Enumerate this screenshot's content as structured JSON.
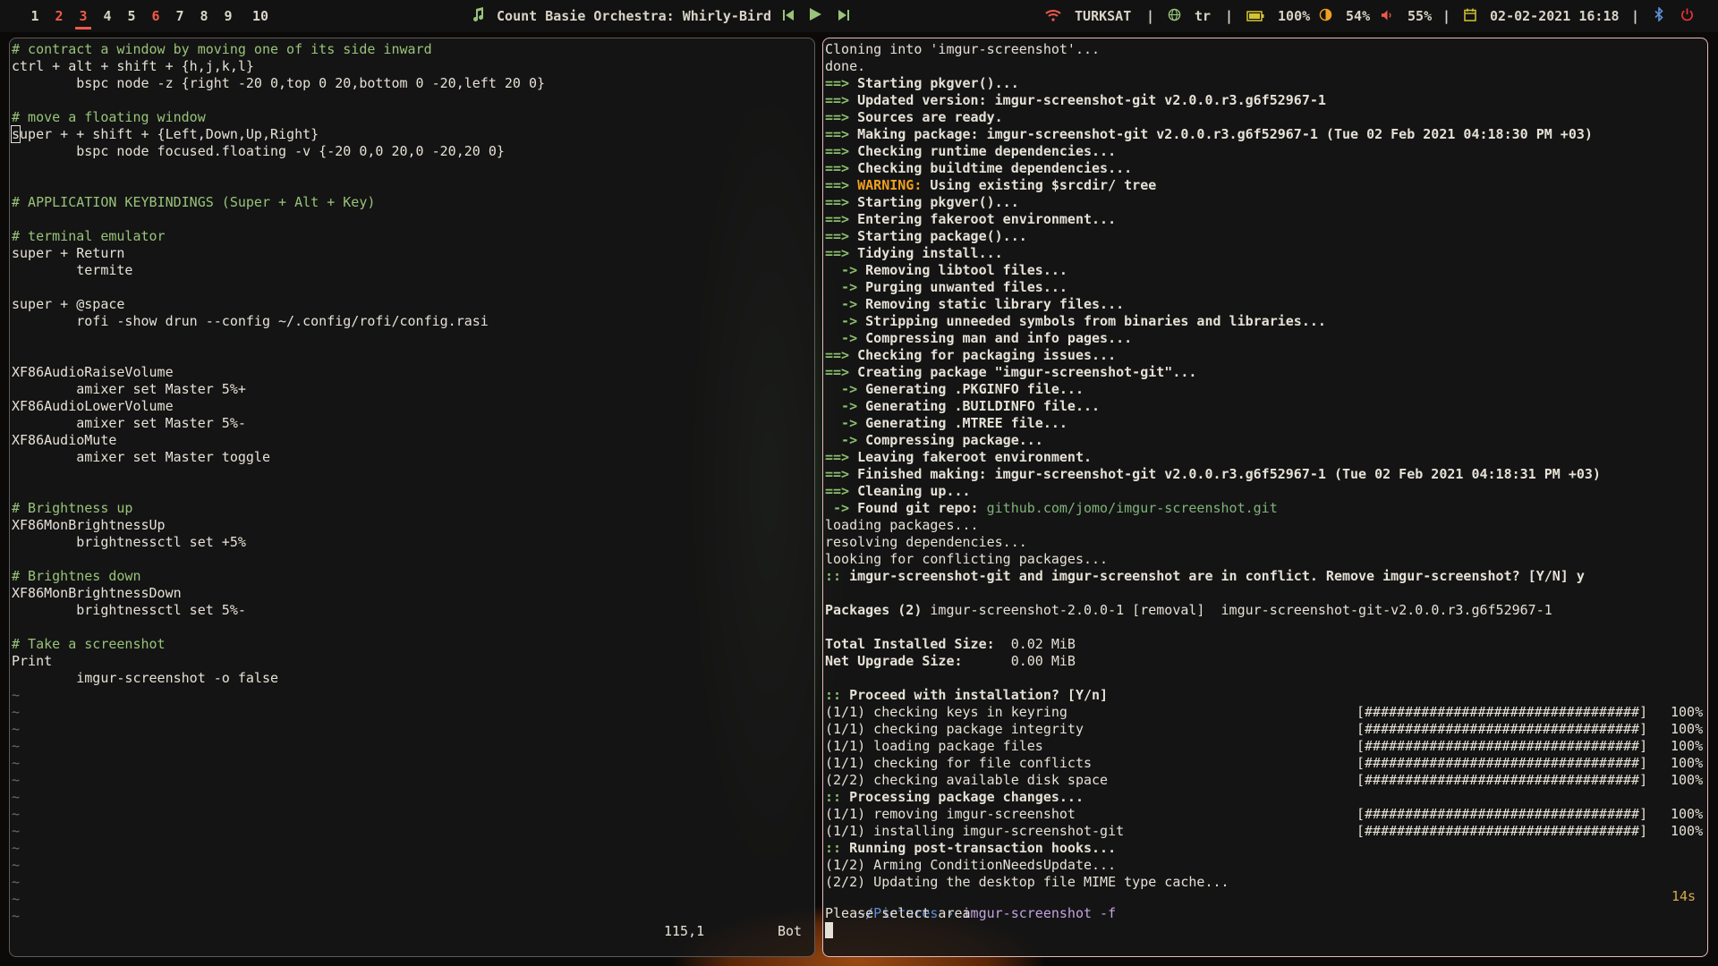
{
  "topbar": {
    "workspaces": [
      "1",
      "2",
      "3",
      "4",
      "5",
      "6",
      "7",
      "8",
      "9",
      "10"
    ],
    "active_workspace": "3",
    "now_playing": "Count Basie Orchestra: Whirly-Bird",
    "wifi": "TURKSAT",
    "layout": "tr",
    "battery": "100%",
    "brightness": "54%",
    "volume": "55%",
    "datetime": "02-02-2021 16:18",
    "separator": "|"
  },
  "editor": {
    "lines": [
      "# contract a window by moving one of its side inward",
      "ctrl + alt + shift + {h,j,k,l}",
      "        bspc node -z {right -20 0,top 0 20,bottom 0 -20,left 20 0}",
      "",
      "# move a floating window",
      "super + + shift + {Left,Down,Up,Right}",
      "        bspc node focused.floating -v {-20 0,0 20,0 -20,20 0}",
      "",
      "",
      "# APPLICATION KEYBINDINGS (Super + Alt + Key)",
      "",
      "# terminal emulator",
      "super + Return",
      "        termite",
      "",
      "super + @space",
      "        rofi -show drun --config ~/.config/rofi/config.rasi",
      "",
      "",
      "XF86AudioRaiseVolume",
      "        amixer set Master 5%+",
      "XF86AudioLowerVolume",
      "        amixer set Master 5%-",
      "XF86AudioMute",
      "        amixer set Master toggle",
      "",
      "",
      "# Brightness up",
      "XF86MonBrightnessUp",
      "        brightnessctl set +5%",
      "",
      "# Brightnes down",
      "XF86MonBrightnessDown",
      "        brightnessctl set 5%-",
      "",
      "# Take a screenshot",
      "Print",
      "        imgur-screenshot -o false",
      "~",
      "~",
      "~",
      "~",
      "~",
      "~",
      "~",
      "~",
      "~",
      "~",
      "~",
      "~",
      "~",
      "~"
    ],
    "status_position": "115,1",
    "status_scroll": "Bot"
  },
  "terminal": {
    "lines": [
      "Cloning into 'imgur-screenshot'...",
      "done.",
      "==> Starting pkgver()...",
      "==> Updated version: imgur-screenshot-git v2.0.0.r3.g6f52967-1",
      "==> Sources are ready.",
      "==> Making package: imgur-screenshot-git v2.0.0.r3.g6f52967-1 (Tue 02 Feb 2021 04:18:30 PM +03)",
      "==> Checking runtime dependencies...",
      "==> Checking buildtime dependencies...",
      "==> WARNING: Using existing $srcdir/ tree",
      "==> Starting pkgver()...",
      "==> Entering fakeroot environment...",
      "==> Starting package()...",
      "==> Tidying install...",
      "  -> Removing libtool files...",
      "  -> Purging unwanted files...",
      "  -> Removing static library files...",
      "  -> Stripping unneeded symbols from binaries and libraries...",
      "  -> Compressing man and info pages...",
      "==> Checking for packaging issues...",
      "==> Creating package \"imgur-screenshot-git\"...",
      "  -> Generating .PKGINFO file...",
      "  -> Generating .BUILDINFO file...",
      "  -> Generating .MTREE file...",
      "  -> Compressing package...",
      "==> Leaving fakeroot environment.",
      "==> Finished making: imgur-screenshot-git v2.0.0.r3.g6f52967-1 (Tue 02 Feb 2021 04:18:31 PM +03)",
      "==> Cleaning up...",
      " -> Found git repo: github.com/jomo/imgur-screenshot.git",
      "loading packages...",
      "resolving dependencies...",
      "looking for conflicting packages...",
      ":: imgur-screenshot-git and imgur-screenshot are in conflict. Remove imgur-screenshot? [Y/N] y",
      "",
      "Packages (2) imgur-screenshot-2.0.0-1 [removal]  imgur-screenshot-git-v2.0.0.r3.g6f52967-1",
      "",
      "Total Installed Size:  0.02 MiB",
      "Net Upgrade Size:      0.00 MiB",
      "",
      ":: Proceed with installation? [Y/n]",
      "(1/1) checking keys in keyring",
      "(1/1) checking package integrity",
      "(1/1) loading package files",
      "(1/1) checking for file conflicts",
      "(2/2) checking available disk space",
      ":: Processing package changes...",
      "(1/1) removing imgur-screenshot",
      "(1/1) installing imgur-screenshot-git",
      ":: Running post-transaction hooks...",
      "(1/2) Arming ConditionNeedsUpdate...",
      "(2/2) Updating the desktop file MIME type cache..."
    ],
    "progress_bar": "[##################################]",
    "progress_pct": "100%",
    "prompt_dir": "~/Pictures",
    "prompt_sep": "›",
    "prompt_cmd": "imgur-screenshot -f",
    "prompt_elapsed": "14s",
    "output_last": "Please select area"
  },
  "colors": {
    "accent": "#ee5a4a",
    "comment": "#98c379",
    "active_border": "#e5b9bd",
    "inactive_border": "#5c5c5c"
  }
}
